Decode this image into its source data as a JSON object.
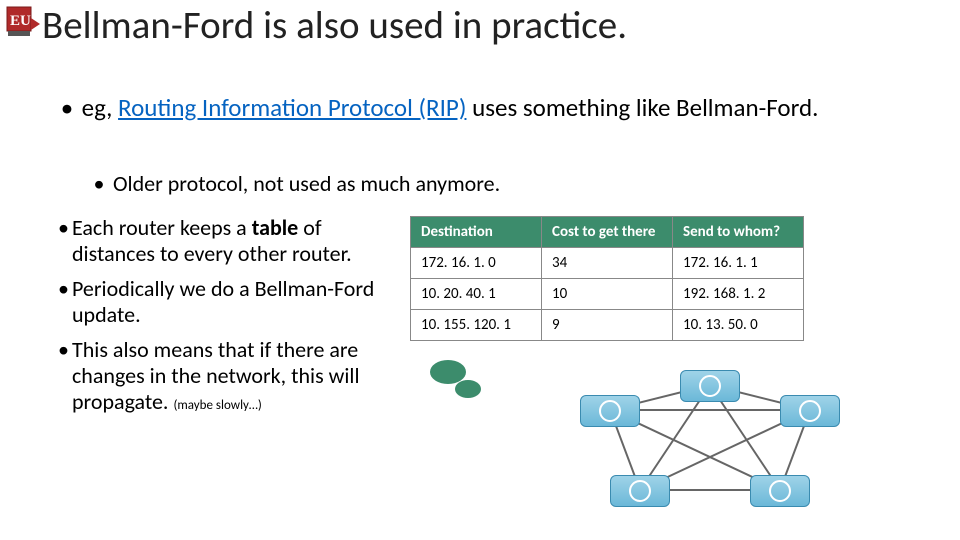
{
  "title": "Bellman-Ford is also used in practice.",
  "bullet1_pre": "eg, ",
  "bullet1_link": "Routing Information Protocol (RIP)",
  "bullet1_post": " uses something like Bellman-Ford.",
  "bullet2": "Older protocol, not used as much anymore.",
  "left": {
    "i1a": "Each router keeps a ",
    "i1b": "table",
    "i1c": " of distances to every other router.",
    "i2": "Periodically we do a Bellman-Ford update.",
    "i3a": "This also means that if there are changes in the network, this will propagate. ",
    "i3b": "(maybe slowly…)"
  },
  "table": {
    "h1": "Destination",
    "h2": "Cost to get there",
    "h3": "Send to whom?",
    "rows": [
      {
        "a": "172. 16. 1. 0",
        "b": "34",
        "c": "172. 16. 1. 1"
      },
      {
        "a": "10. 20. 40. 1",
        "b": "10",
        "c": "192. 168. 1. 2"
      },
      {
        "a": "10. 155. 120. 1",
        "b": "9",
        "c": "10. 13. 50. 0"
      }
    ]
  },
  "chart_data": {
    "type": "table",
    "title": "Routing table example",
    "columns": [
      "Destination",
      "Cost to get there",
      "Send to whom?"
    ],
    "rows": [
      [
        "172.16.1.0",
        34,
        "172.16.1.1"
      ],
      [
        "10.20.40.1",
        10,
        "192.168.1.2"
      ],
      [
        "10.155.120.1",
        9,
        "10.13.50.0"
      ]
    ]
  }
}
